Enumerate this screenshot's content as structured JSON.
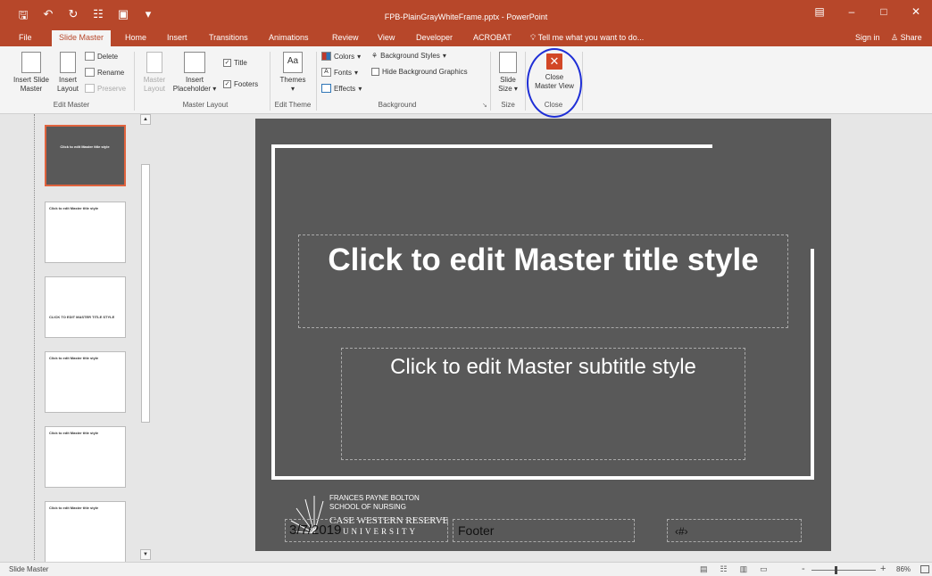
{
  "window": {
    "title": "FPB-PlainGrayWhiteFrame.pptx - PowerPoint",
    "qat_icons": [
      "save-icon",
      "undo-icon",
      "redo-icon",
      "format-painter-icon",
      "start-from-beginning-icon",
      "customize-qat-icon"
    ],
    "controls": [
      "ribbon-display-icon",
      "minimize-icon",
      "maximize-icon",
      "close-window-icon"
    ]
  },
  "tabs": [
    "File",
    "Slide Master",
    "Home",
    "Insert",
    "Transitions",
    "Animations",
    "Review",
    "View",
    "Developer",
    "ACROBAT"
  ],
  "tell_me": "Tell me what you want to do...",
  "sign_in": "Sign in",
  "share": "Share",
  "ribbon": {
    "edit_master": {
      "label": "Edit Master",
      "insert_slide_master": [
        "Insert Slide",
        "Master"
      ],
      "insert_layout": [
        "Insert",
        "Layout"
      ],
      "delete": "Delete",
      "rename": "Rename",
      "preserve": "Preserve"
    },
    "master_layout": {
      "label": "Master Layout",
      "master_layout_btn": [
        "Master",
        "Layout"
      ],
      "insert_placeholder": [
        "Insert",
        "Placeholder"
      ],
      "title": "Title",
      "footers": "Footers",
      "title_checked": true,
      "footers_checked": true
    },
    "edit_theme": {
      "label": "Edit Theme",
      "themes": "Themes"
    },
    "background": {
      "label": "Background",
      "colors": "Colors",
      "fonts": "Fonts",
      "effects": "Effects",
      "background_styles": "Background Styles",
      "hide_background_graphics": "Hide Background Graphics"
    },
    "size": {
      "label": "Size",
      "slide_size": [
        "Slide",
        "Size"
      ]
    },
    "close": {
      "label": "Close",
      "close_master_view": [
        "Close",
        "Master View"
      ]
    }
  },
  "thumbnails": [
    {
      "title": "Click to edit Master title style",
      "selected": true
    },
    {
      "title": "Click to edit Master title style",
      "selected": false
    },
    {
      "title": "CLICK TO EDIT MASTER TITLE STYLE",
      "selected": false
    },
    {
      "title": "Click to edit Master title style",
      "selected": false
    },
    {
      "title": "Click to edit Master title style",
      "selected": false
    },
    {
      "title": "Click to edit Master title style",
      "selected": false
    }
  ],
  "slide": {
    "title": "Click to edit Master title style",
    "subtitle": "Click to edit Master subtitle style",
    "date": "3/7/2019",
    "footer": "Footer",
    "slide_number": "‹#›",
    "logo_lines": [
      "FRANCES PAYNE BOLTON",
      "SCHOOL OF NURSING",
      "CASE WESTERN RESERVE",
      "UNIVERSITY"
    ]
  },
  "status": {
    "view_name": "Slide Master",
    "zoom": "86%",
    "minus": "-",
    "plus": "+"
  },
  "accent_color": "#b7472a",
  "annotation_color": "#1f2fd6"
}
